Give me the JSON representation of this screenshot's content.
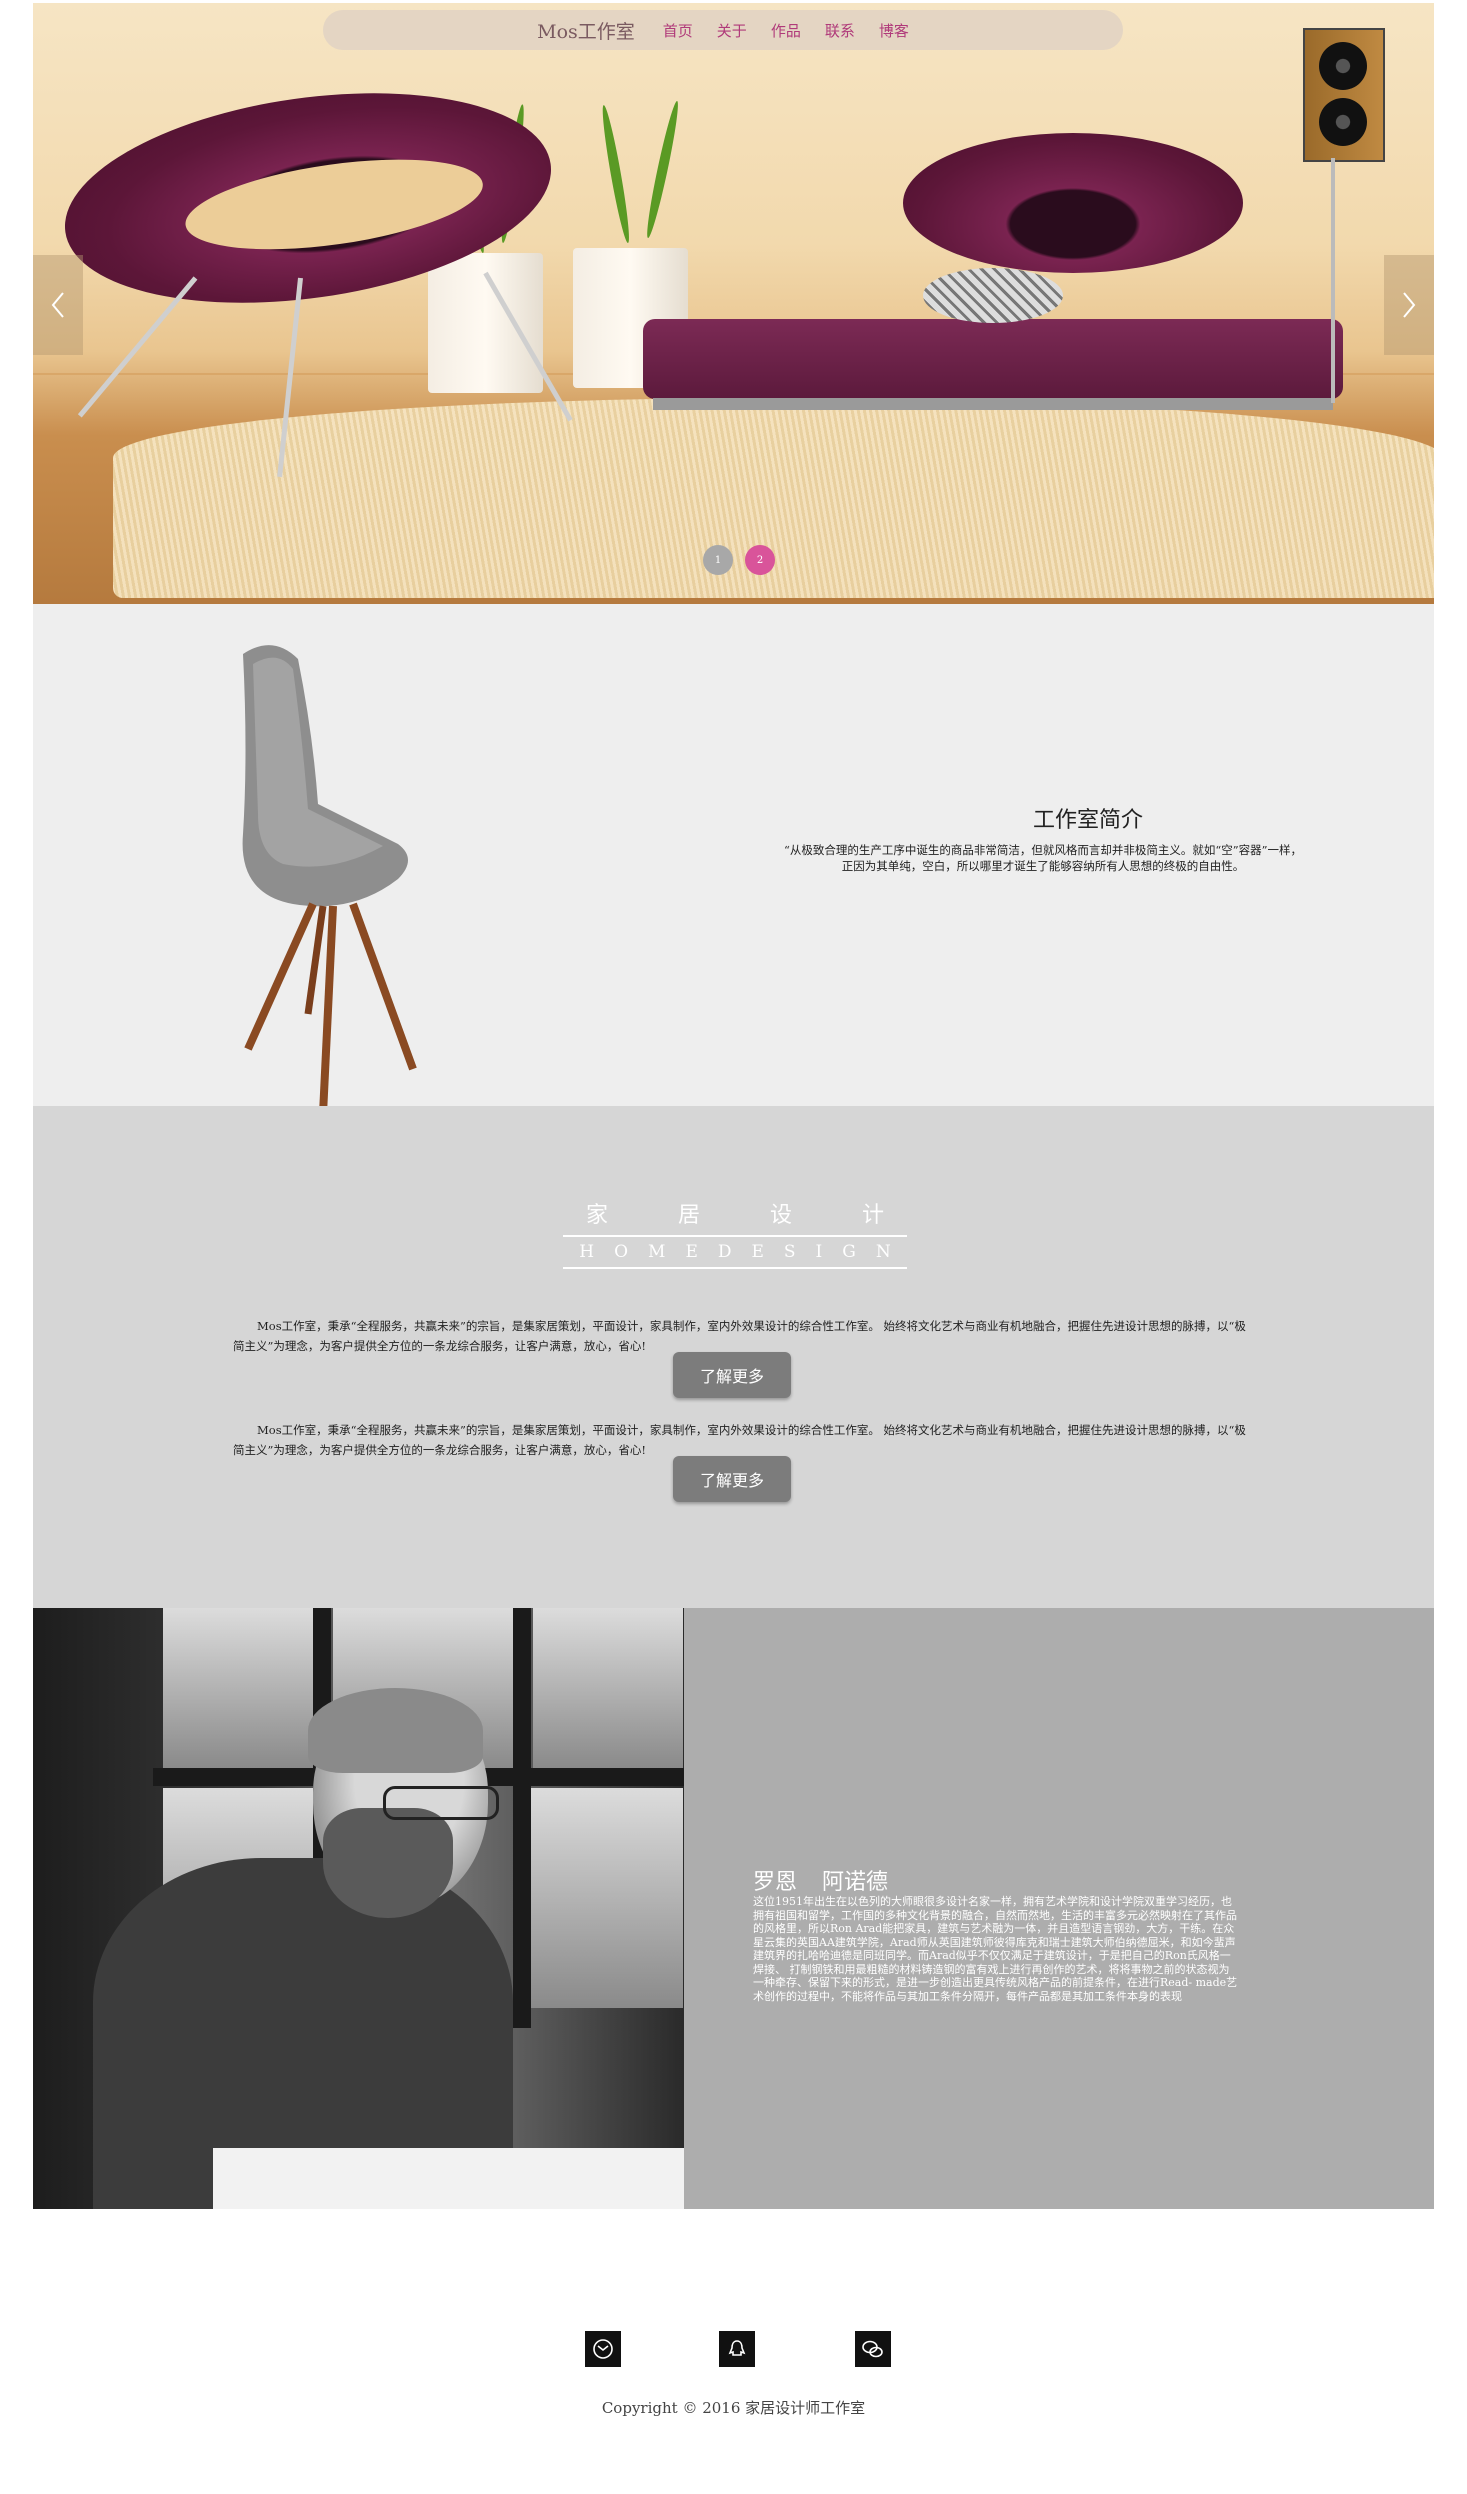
{
  "nav": {
    "brand": "Mos工作室",
    "links": [
      "首页",
      "关于",
      "作品",
      "联系",
      "博客"
    ]
  },
  "slider": {
    "prev_icon": "chevron-left-icon",
    "next_icon": "chevron-right-icon",
    "dots": [
      "1",
      "2"
    ],
    "active_dot": 2
  },
  "intro": {
    "title": "工作室简介",
    "text": "“从极致合理的生产工序中诞生的商品非常简洁，但就风格而言却并非极简主义。就如“空”容器”一样，正因为其单纯，空白，所以哪里才诞生了能够容纳所有人思想的终极的自由性。"
  },
  "design": {
    "heading_cn": "家居设计",
    "heading_en": "HOMEDESIGN",
    "paragraph1": "Mos工作室，秉承“全程服务，共赢未来”的宗旨，是集家居策划，平面设计，家具制作，室内外效果设计的综合性工作室。   始终将文化艺术与商业有机地融合，把握住先进设计思想的脉搏，以“极简主义”为理念，为客户提供全方位的一条龙综合服务，让客户满意，放心，省心!",
    "paragraph2": "Mos工作室，秉承“全程服务，共赢未来”的宗旨，是集家居策划，平面设计，家具制作，室内外效果设计的综合性工作室。   始终将文化艺术与商业有机地融合，把握住先进设计思想的脉搏，以“极简主义”为理念，为客户提供全方位的一条龙综合服务，让客户满意，放心，省心!",
    "button1": "了解更多",
    "button2": "了解更多"
  },
  "profile": {
    "name": "罗恩 阿诺德",
    "bio": "这位1951年出生在以色列的大师眼很多设计名家一样，拥有艺术学院和设计学院双重学习经历，也拥有祖国和留学，工作国的多种文化背景的融合，自然而然地，生活的丰富多元必然映射在了其作品的风格里，所以Ron Arad能把家具，建筑与艺术融为一体，并且造型语言钢劲，大方，干练。在众星云集的英国AA建筑学院，Arad师从英国建筑师彼得库克和瑞士建筑大师伯纳德屈米，和如今蜚声建筑界的扎哈哈迪德是同班同学。而Arad似乎不仅仅满足于建筑设计，于是把自己的Ron氏风格一焊接、 打制钢铁和用最粗糙的材料铸造钢的富有戏上进行再创作的艺术，将将事物之前的状态视为一种牵存、保留下来的形式，是进一步创造出更具传统风格产品的前提条件，在进行Read- made艺术创作的过程中，不能将作品与其加工条件分隔开，每件产品都是其加工条件本身的表现"
  },
  "footer": {
    "icons": [
      "mail-icon",
      "qq-icon",
      "wechat-icon"
    ],
    "copyright": "Copyright © 2016 家居设计师工作室"
  }
}
